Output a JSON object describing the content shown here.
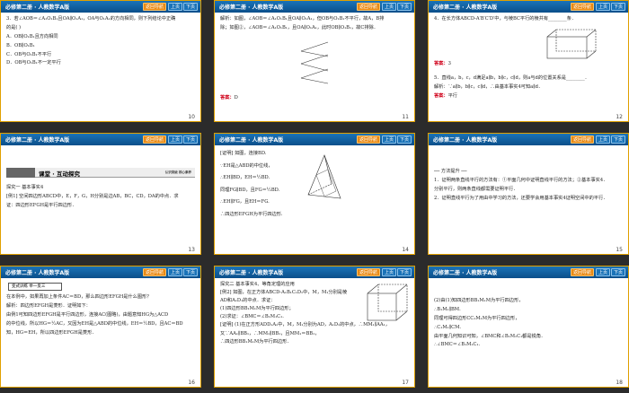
{
  "header_title": "必修第二册 · 人教数学A版",
  "buttons": {
    "nav": "返回导航",
    "prev": "上页",
    "next": "下页"
  },
  "slides": [
    {
      "page": "10",
      "lines": [
        "3．若∠AOB＝∠A₁O₁B₁且OA∥O₁A₁，OA与O₁A₁的方向相同，则下列结论中正确",
        "的是(      )",
        "A．OB∥O₁B₁且方向相同",
        "B．OB∥O₁B₁",
        "C．OB与O₁B₁不平行",
        "D．OB与O₁B₁不一定平行"
      ]
    },
    {
      "page": "11",
      "lines": [
        "解析：如图，∠AOB＝∠A₁O₁B₁且OA∥O₁A₁，但OB与O₁B₁不平行，故A，B排",
        "除；如图②，∠AOB＝∠A₁O₁B₁，且OA∥O₁A₁，此时OB∥O₁B₁，故C排除．"
      ],
      "answer_label": "答案：",
      "answer": "D"
    },
    {
      "page": "12",
      "lines": [
        "4．在长方体ABCD-A′B′C′D′中，与棱BC平行的棱共有________条．"
      ],
      "answer_label": "答案：",
      "answer": "3",
      "q5": "5．直线a，b，c，d满足a∥b，b∥c，c∥d，则a与d的位置关系是________．",
      "q5_ans_pre": "解析：∵a∥b，b∥c，c∥d，∴由基本事实4可知a∥d．",
      "q5_answer": "平行"
    },
    {
      "page": "13",
      "section": "课堂 · 互动探究",
      "section_sub": "认识突破  核心素养",
      "lines": [
        "探究一    基本事实4",
        "[例1]  空间四边形ABCD中，E，F，G，H分别是边AB，BC，CD，DA的中点．求",
        "证：四边形EFGH是平行四边形．"
      ]
    },
    {
      "page": "14",
      "lines": [
        "[证明]  如图，连接BD.",
        "∵EH是△ABD的中位线，",
        "∴EH∥BD，EH＝½BD.",
        "同理FG∥BD，且FG＝½BD.",
        "∴EH∥FG，且EH＝FG.",
        "∴四边形EFGH为平行四边形."
      ]
    },
    {
      "page": "15",
      "lines": [
        "── 方法提升 ──",
        "1．证明两条直线平行的方法有：①平面几何中证明直线平行的方法；②基本事实4．",
        "分别平行，则两条直线都需要证明平行．",
        "2．证明直线平行为了用由中学习的方法，还要学会用基本事实4证明空间中的平行．"
      ]
    },
    {
      "page": "16",
      "box": "变式训练  举一反三",
      "lines": [
        "在本例中，如果再加上条件AC＝BD，那么四边形EFGH是什么图形？",
        "",
        "解析：四边形EFGH是菱形．证明如下：",
        "由例1可知四边形EFGH是平行四边形，连接AC(图略)，由题意知HG为△ACD",
        "的中位线，所以HG＝½AC，又因为EH是△ABD的中位线，EH＝½BD，且AC＝BD",
        "知，HG＝EH，所以四边形EFGH是菱形．"
      ]
    },
    {
      "page": "17",
      "lines": [
        "探究二    基本事实4、等角定理的应用",
        "[例2]  如图，在正方体ABCD-A₁B₁C₁D₁中，M，M₁分别是棱",
        "AD和A₁D₁的中点．求证：",
        "(1)四边形BB₁M₁M为平行四边形；",
        "(2)求证：∠BMC＝∠B₁M₁C₁.",
        "[证明]  (1)在正方形ADD₁A₁中，M，M₁分别为AD，A₁D₁的中点，∴MM₁∥AA₁，",
        "",
        "又∵AA₁∥BB₁，∴MM₁∥BB₁，且MM₁＝BB₁，",
        "∴四边形BB₁M₁M为平行四边形．"
      ]
    },
    {
      "page": "18",
      "lines": [
        "(2)由(1)知四边形BB₁M₁M为平行四边形，",
        "∴B₁M₁∥BM.",
        "同理可得四边形CC₁M₁M为平行四边形，",
        "∴C₁M₁∥CM.",
        "由平面几何知识可知，∠BMC和∠B₁M₁C₁都是锐角．",
        "∴∠BMC＝∠B₁M₁C₁."
      ]
    }
  ]
}
